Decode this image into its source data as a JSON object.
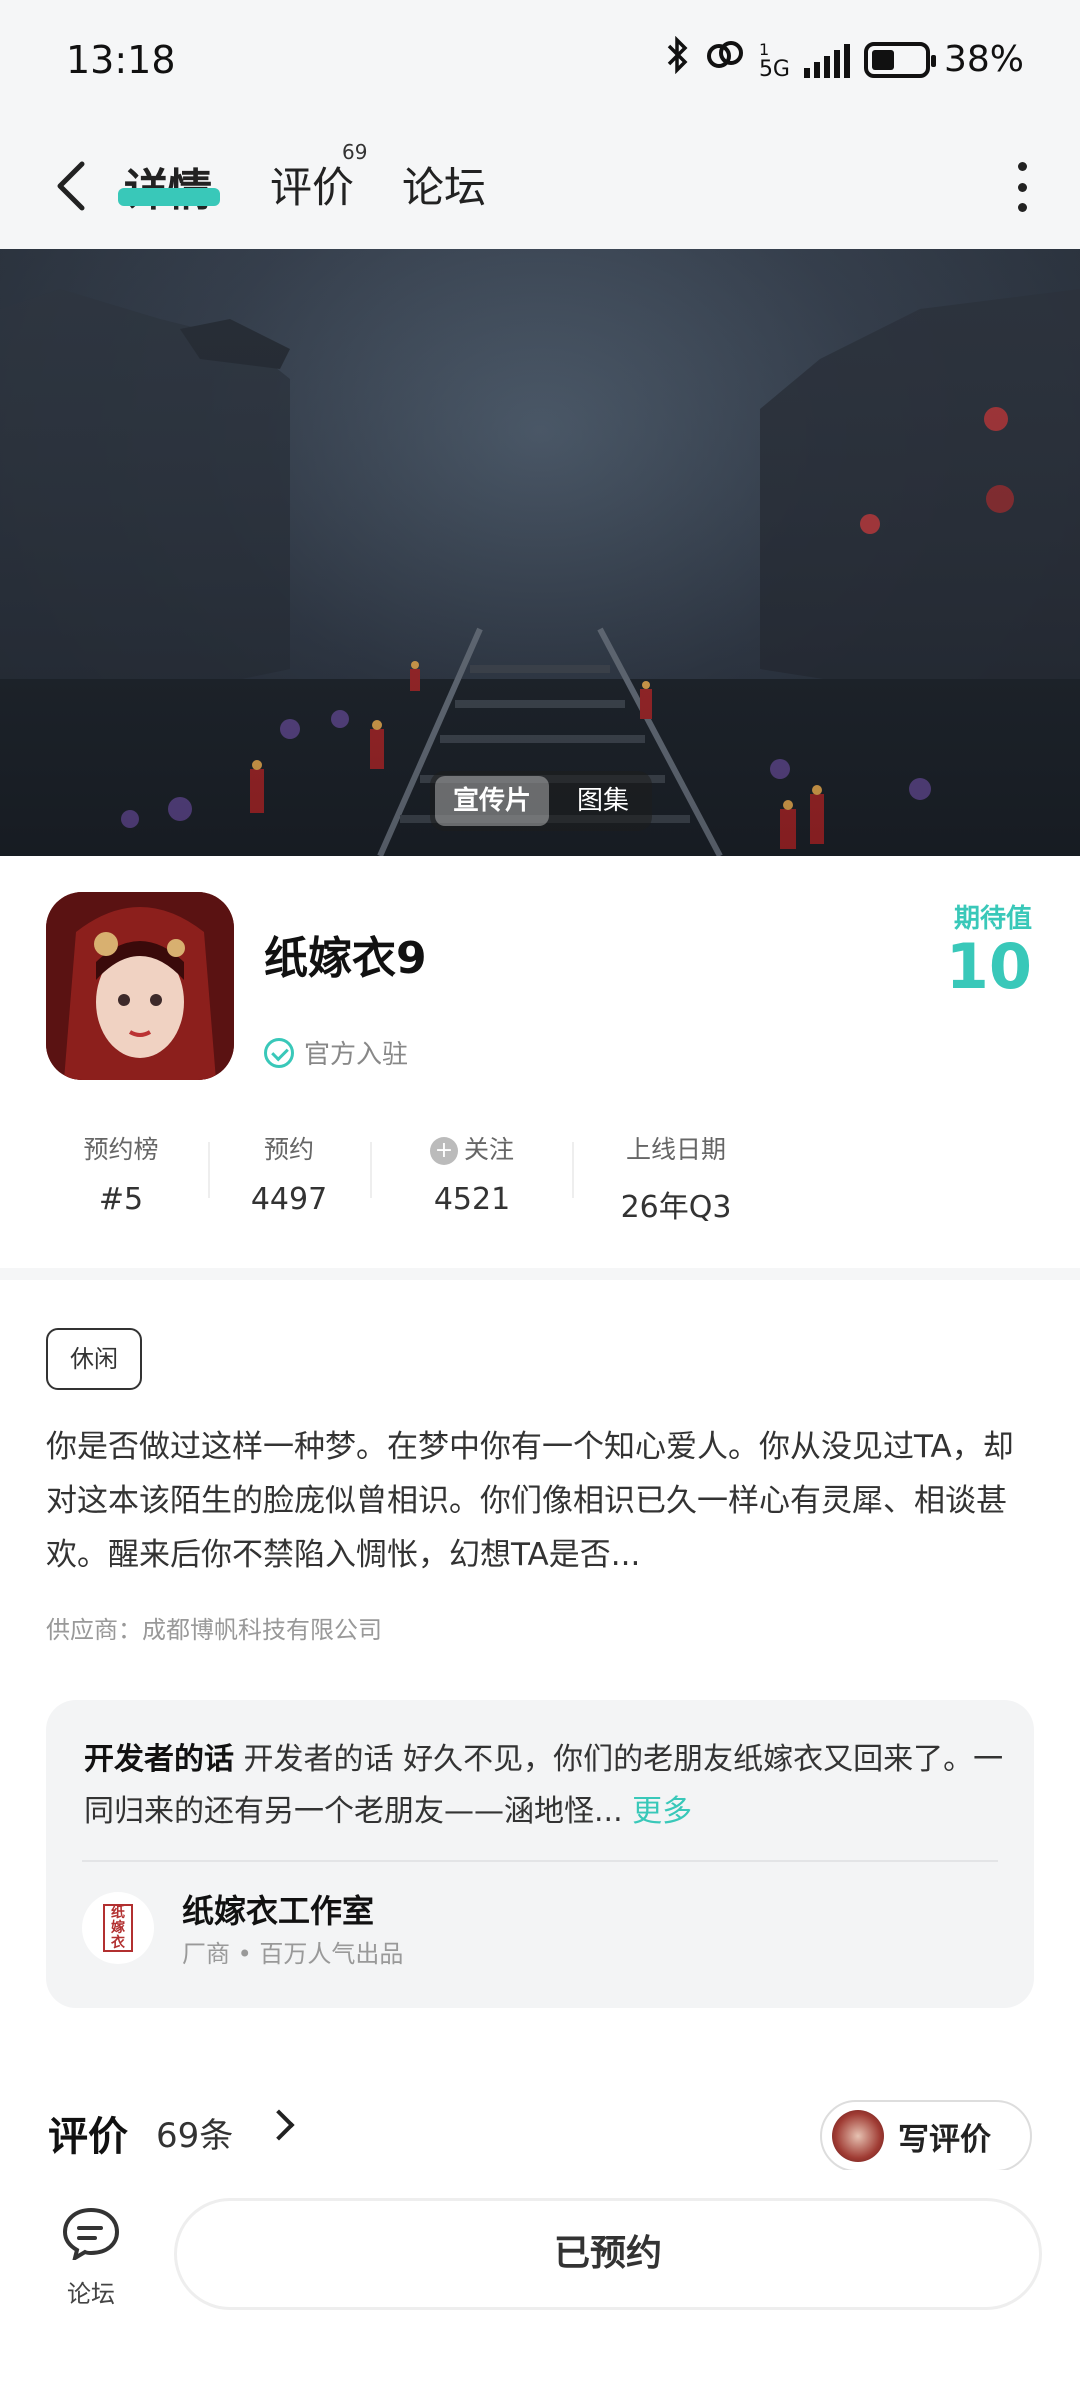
{
  "status_bar": {
    "time": "13:18",
    "network": "5G",
    "network_sup": "1",
    "battery": "38%"
  },
  "nav": {
    "tabs": [
      {
        "label": "详情",
        "active": true
      },
      {
        "label": "评价",
        "badge": "69"
      },
      {
        "label": "论坛"
      }
    ]
  },
  "banner": {
    "toggle": [
      "宣传片",
      "图集"
    ]
  },
  "game": {
    "title": "纸嫁衣9",
    "official_label": "官方入驻",
    "expect_label": "期待值",
    "expect_value": "10",
    "stats": [
      {
        "label": "预约榜",
        "value": "#5"
      },
      {
        "label": "预约",
        "value": "4497"
      },
      {
        "label": "关注",
        "value": "4521"
      },
      {
        "label": "上线日期",
        "value": "26年Q3"
      }
    ]
  },
  "description": {
    "tag": "休闲",
    "text": "你是否做过这样一种梦。在梦中你有一个知心爱人。你从没见过TA，却对这本该陌生的脸庞似曾相识。你们像相识已久一样心有灵犀、相谈甚欢。醒来后你不禁陷入惆怅，幻想TA是否...",
    "vendor": "供应商：成都博帆科技有限公司"
  },
  "developer": {
    "heading": "开发者的话",
    "text": "开发者的话 好久不见，你们的老朋友纸嫁衣又回来了。一同归来的还有另一个老朋友——涵地怪...",
    "more": "更多",
    "studio_name": "纸嫁衣工作室",
    "studio_sub": "厂商 • 百万人气出品",
    "logo_text": "纸嫁衣"
  },
  "reviews": {
    "title": "评价",
    "count": "69条",
    "write_label": "写评价"
  },
  "bottom": {
    "forum_label": "论坛",
    "reserve_label": "已预约"
  },
  "colors": {
    "accent": "#39c8b9"
  }
}
